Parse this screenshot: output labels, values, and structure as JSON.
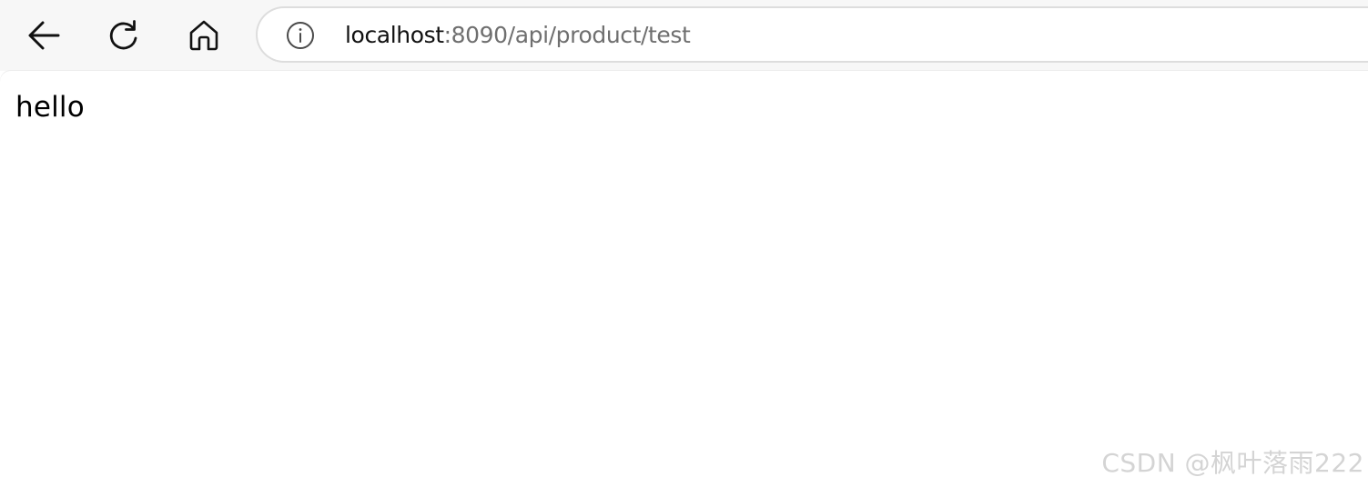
{
  "browser": {
    "url_host": "localhost",
    "url_rest": ":8090/api/product/test",
    "icons": {
      "back": "arrow-left-icon",
      "refresh": "refresh-icon",
      "home": "home-icon",
      "site_info": "info-circle-icon"
    }
  },
  "page": {
    "body_text": "hello"
  },
  "watermark": {
    "text": "CSDN @枫叶落雨222"
  }
}
